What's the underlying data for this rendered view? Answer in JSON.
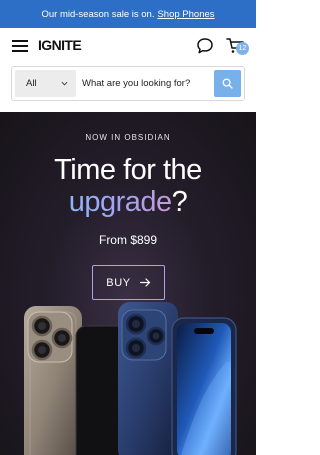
{
  "announcement": {
    "text": "Our mid-season sale is on.",
    "link": "Shop Phones"
  },
  "header": {
    "logo": "IGNITE",
    "cart_count": "12"
  },
  "search": {
    "category": "All",
    "placeholder": "What are you looking for?"
  },
  "hero": {
    "eyebrow": "NOW IN OBSIDIAN",
    "title_line1": "Time for the",
    "title_highlight": "upgrade",
    "title_suffix": "?",
    "price": "From $899",
    "cta": "BUY"
  },
  "colors": {
    "announcement_bg": "#2d6fc6",
    "search_button": "#78b0ea",
    "cta_border": "#b69ee6"
  },
  "icons": [
    "menu-icon",
    "chat-icon",
    "cart-icon",
    "chevron-down-icon",
    "search-icon",
    "arrow-right-icon"
  ]
}
